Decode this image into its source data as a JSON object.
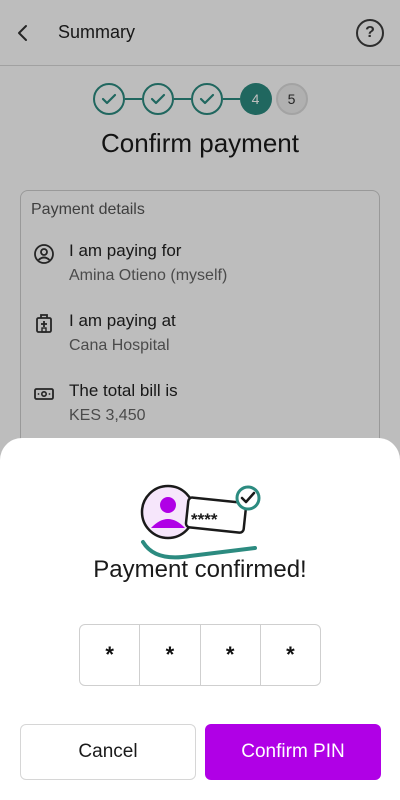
{
  "header": {
    "title": "Summary",
    "help_glyph": "?"
  },
  "stepper": {
    "steps": [
      {
        "label": "",
        "state": "done"
      },
      {
        "label": "",
        "state": "done"
      },
      {
        "label": "",
        "state": "done"
      },
      {
        "label": "4",
        "state": "current"
      },
      {
        "label": "5",
        "state": "todo"
      }
    ]
  },
  "heading": "Confirm payment",
  "payment_details": {
    "title": "Payment details",
    "rows": [
      {
        "icon": "person-icon",
        "label": "I am paying for",
        "value": "Amina Otieno (myself)"
      },
      {
        "icon": "hospital-icon",
        "label": "I am paying at",
        "value": "Cana Hospital"
      },
      {
        "icon": "cash-icon",
        "label": "The total bill is",
        "value": "KES 3,450"
      }
    ]
  },
  "sheet": {
    "message": "Payment confirmed!",
    "illustration_text": "****",
    "pin": [
      "*",
      "*",
      "*",
      "*"
    ],
    "cancel_label": "Cancel",
    "confirm_label": "Confirm PIN"
  },
  "colors": {
    "primary_teal": "#2c8b80",
    "accent_purple": "#b000e6",
    "overlay": "rgba(0,0,0,0.26)"
  }
}
